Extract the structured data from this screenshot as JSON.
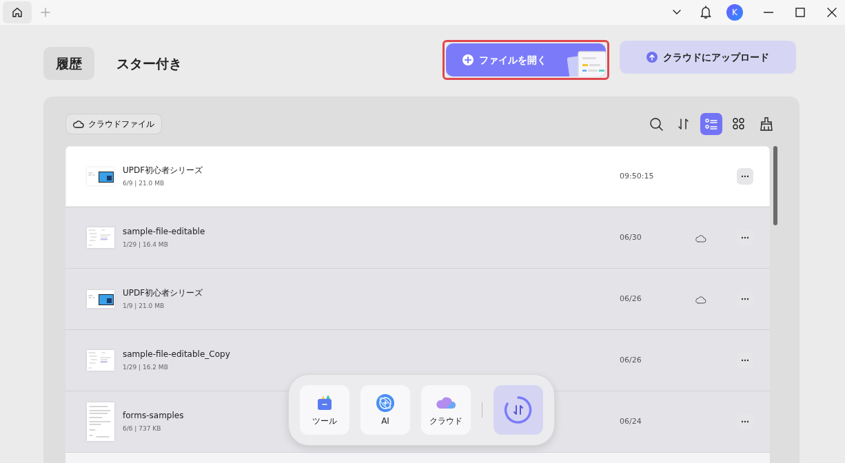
{
  "titlebar": {
    "avatar": "K"
  },
  "tabs": [
    {
      "label": "履歴",
      "selected": true
    },
    {
      "label": "スター付き",
      "selected": false
    }
  ],
  "actions": [
    {
      "kind": "open",
      "label": "ファイルを開く",
      "highlighted": true
    },
    {
      "kind": "upload",
      "label": "クラウドにアップロード",
      "highlighted": false
    }
  ],
  "filter_chip": {
    "label": "クラウドファイル"
  },
  "toolbar": [
    {
      "kind": "search",
      "selected": false
    },
    {
      "kind": "sort",
      "selected": false
    },
    {
      "kind": "list",
      "selected": true
    },
    {
      "kind": "grid",
      "selected": false
    },
    {
      "kind": "clean",
      "selected": false
    }
  ],
  "files": [
    {
      "name": "UPDF初心者シリーズ",
      "meta": "6/9 | 21.0 MB",
      "date": "09:50:15",
      "cloud": false,
      "selected": true,
      "kind": "slide"
    },
    {
      "name": "sample-file-editable",
      "meta": "1/29 | 16.4 MB",
      "date": "06/30",
      "cloud": true,
      "selected": false,
      "kind": "text"
    },
    {
      "name": "UPDF初心者シリーズ",
      "meta": "1/9 | 21.0 MB",
      "date": "06/26",
      "cloud": true,
      "selected": false,
      "kind": "slide"
    },
    {
      "name": "sample-file-editable_Copy",
      "meta": "1/29 | 16.2 MB",
      "date": "06/26",
      "cloud": false,
      "selected": false,
      "kind": "text"
    },
    {
      "name": "forms-samples",
      "meta": "6/6 | 737 KB",
      "date": "06/24",
      "cloud": false,
      "selected": false,
      "kind": "form"
    }
  ],
  "dock": [
    {
      "kind": "tools",
      "label": "ツール"
    },
    {
      "kind": "ai",
      "label": "AI"
    },
    {
      "kind": "cloud",
      "label": "クラウド"
    }
  ]
}
